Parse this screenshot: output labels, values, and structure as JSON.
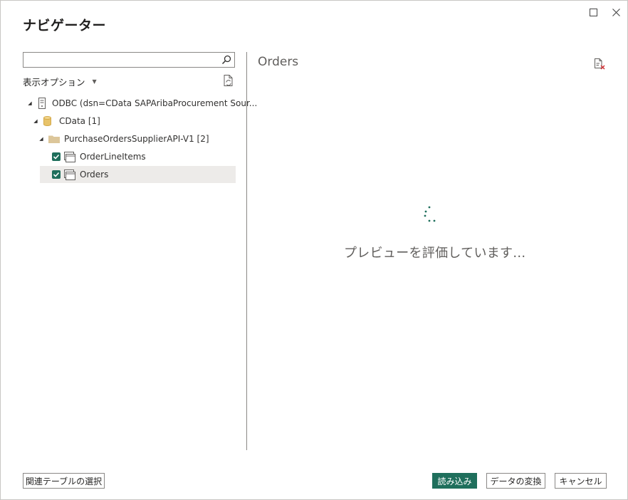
{
  "dialog": {
    "title": "ナビゲーター",
    "maximize_icon": "maximize-icon",
    "close_icon": "close-icon"
  },
  "search": {
    "value": "",
    "placeholder": ""
  },
  "display_options": {
    "label": "表示オプション"
  },
  "tree": {
    "root": {
      "label": "ODBC (dsn=CData SAPAribaProcurement Sour..."
    },
    "db": {
      "label": "CData [1]"
    },
    "folder": {
      "label": "PurchaseOrdersSupplierAPI-V1 [2]"
    },
    "items": [
      {
        "label": "OrderLineItems",
        "checked": true
      },
      {
        "label": "Orders",
        "checked": true
      }
    ]
  },
  "preview": {
    "title": "Orders",
    "loading_text": "プレビューを評価しています..."
  },
  "footer": {
    "related_tables_label": "関連テーブルの選択",
    "load_label": "読み込み",
    "transform_label": "データの変換",
    "cancel_label": "キャンセル"
  },
  "colors": {
    "accent": "#1f6f5c",
    "folder": "#dcc69a",
    "db": "#e8c36a",
    "selection": "#edebe9"
  }
}
